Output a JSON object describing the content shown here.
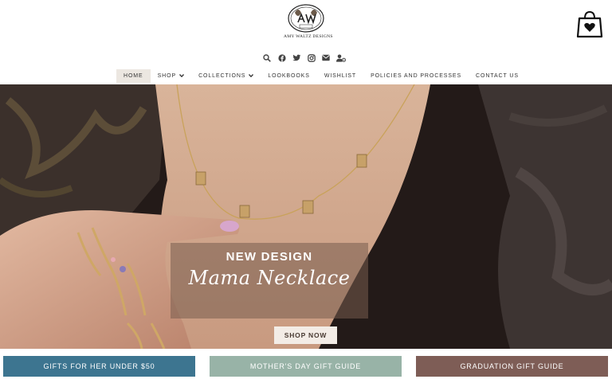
{
  "brand": {
    "name": "AMY WALTZ DESIGNS",
    "logo_monogram": "AW"
  },
  "header": {
    "cart_icon": "shopping-bag-heart-icon",
    "social_icons": [
      "search-icon",
      "facebook-icon",
      "twitter-icon",
      "instagram-icon",
      "email-icon",
      "account-icon"
    ]
  },
  "nav": {
    "items": [
      {
        "label": "HOME",
        "active": true
      },
      {
        "label": "SHOP",
        "dropdown": true
      },
      {
        "label": "COLLECTIONS",
        "dropdown": true
      },
      {
        "label": "LOOKBOOKS"
      },
      {
        "label": "WISHLIST"
      },
      {
        "label": "POLICIES AND PROCESSES"
      },
      {
        "label": "CONTACT US"
      }
    ]
  },
  "hero": {
    "title": "NEW DESIGN",
    "script_title": "Mama Necklace",
    "button_label": "SHOP NOW"
  },
  "guides": [
    {
      "label": "GIFTS FOR HER UNDER $50",
      "color": "#3d7590"
    },
    {
      "label": "MOTHER'S DAY GIFT GUIDE",
      "color": "#98b3a7"
    },
    {
      "label": "GRADUATION GIFT GUIDE",
      "color": "#7e5d56"
    }
  ],
  "colors": {
    "nav_active_bg": "#ece7e1",
    "promo_overlay": "#785c4e",
    "shop_now_bg": "#f3ece6"
  }
}
